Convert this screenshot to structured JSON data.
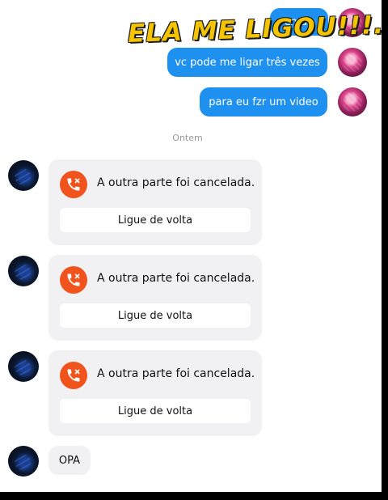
{
  "overlay": {
    "title": "ELA ME LIGOU!!!..."
  },
  "sent_messages": [
    {
      "text": "eman"
    },
    {
      "text": "vc pode me ligar três vezes"
    },
    {
      "text": "para eu fzr um video"
    }
  ],
  "date_separator": "Ontem",
  "calls": [
    {
      "status": "A outra parte foi cancelada.",
      "action": "Ligue de volta"
    },
    {
      "status": "A outra parte foi cancelada.",
      "action": "Ligue de volta"
    },
    {
      "status": "A outra parte foi cancelada.",
      "action": "Ligue de volta"
    }
  ],
  "received_message": {
    "text": "OPA"
  },
  "colors": {
    "sent_bubble": "#1e90f0",
    "call_icon_bg": "#f0531c",
    "received_bubble": "#f1f1f3",
    "overlay_text": "#f5c400"
  },
  "icons": {
    "avatar_me": "user-avatar-icon",
    "avatar_them": "contact-avatar-icon",
    "call": "missed-call-icon"
  }
}
